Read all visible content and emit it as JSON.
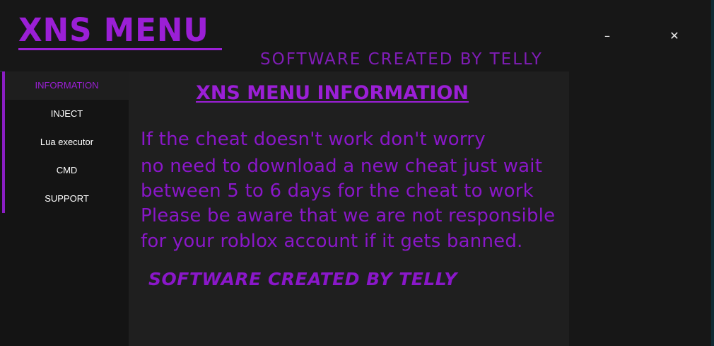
{
  "header": {
    "title": "XNS MENU",
    "subtitle": "SOFTWARE CREATED BY TELLY"
  },
  "window_controls": {
    "minimize": "–",
    "close": "✕"
  },
  "sidebar": {
    "items": [
      {
        "label": "INFORMATION",
        "active": true
      },
      {
        "label": "INJECT",
        "active": false
      },
      {
        "label": "Lua executor",
        "active": false
      },
      {
        "label": "CMD",
        "active": false
      },
      {
        "label": "SUPPORT",
        "active": false
      }
    ]
  },
  "main": {
    "title": "XNS MENU INFORMATION",
    "lines": [
      "If the cheat doesn't work don't worry",
      "no need to download a new cheat just wait",
      "between 5 to 6 days for the cheat to work",
      "Please be aware that we are not responsible",
      "for your roblox account if it gets banned."
    ],
    "footer": "SOFTWARE CREATED BY TELLY"
  },
  "colors": {
    "accent": "#9b1fd6",
    "text_purple": "#8a17c9",
    "background": "#171717",
    "panel": "#1f1f1f"
  }
}
